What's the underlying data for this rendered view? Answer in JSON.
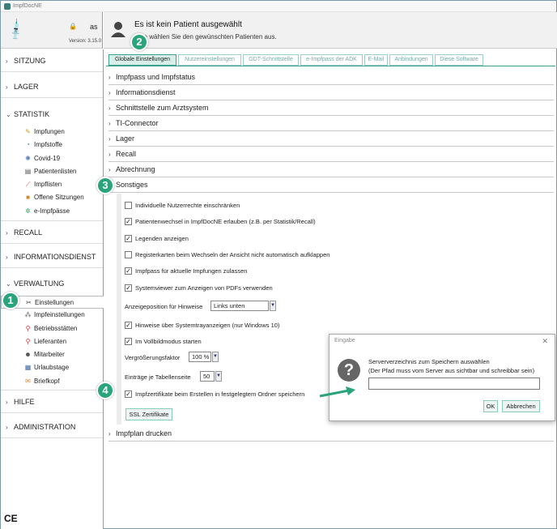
{
  "app": {
    "title": "ImpfDocNE",
    "user": "as",
    "version": "Version: 3.15.0"
  },
  "patient": {
    "title": "Es ist kein Patient ausgewählt",
    "subtitle": "Bitte wählen Sie den gewünschten Patienten aus."
  },
  "callouts": [
    "1",
    "2",
    "3",
    "4"
  ],
  "sidebar": {
    "sections": [
      {
        "label": "SITZUNG",
        "expanded": false
      },
      {
        "label": "LAGER",
        "expanded": false
      },
      {
        "label": "STATISTIK",
        "expanded": true,
        "items": [
          {
            "label": "Impfungen",
            "icon": "syringe-icon"
          },
          {
            "label": "Impfstoffe",
            "icon": "vial-icon"
          },
          {
            "label": "Covid-19",
            "icon": "virus-icon"
          },
          {
            "label": "Patientenlisten",
            "icon": "list-icon"
          },
          {
            "label": "Impflisten",
            "icon": "needle-icon"
          },
          {
            "label": "Offene Sitzungen",
            "icon": "box-icon"
          },
          {
            "label": "e-Impfpässe",
            "icon": "gear-icon"
          }
        ]
      },
      {
        "label": "RECALL",
        "expanded": false
      },
      {
        "label": "INFORMATIONSDIENST",
        "expanded": false
      },
      {
        "label": "VERWALTUNG",
        "expanded": true,
        "items": [
          {
            "label": "Einstellungen",
            "icon": "tools-icon",
            "active": true
          },
          {
            "label": "Impfeinstellungen",
            "icon": "dots-icon"
          },
          {
            "label": "Betriebsstätten",
            "icon": "pin-icon"
          },
          {
            "label": "Lieferanten",
            "icon": "pin-icon"
          },
          {
            "label": "Mitarbeiter",
            "icon": "people-icon"
          },
          {
            "label": "Urlaubstage",
            "icon": "calendar-icon"
          },
          {
            "label": "Briefkopf",
            "icon": "letter-icon"
          }
        ]
      },
      {
        "label": "HILFE",
        "expanded": false
      },
      {
        "label": "ADMINISTRATION",
        "expanded": false
      }
    ],
    "ce_mark": "CE"
  },
  "tabs": [
    {
      "label": "Globale Einstellungen",
      "active": true
    },
    {
      "label": "Nutzereinstellungen"
    },
    {
      "label": "GDT-Schnittstelle"
    },
    {
      "label": "e-Impfpass der ADK"
    },
    {
      "label": "E-Mail"
    },
    {
      "label": "Anbindungen"
    },
    {
      "label": "Diese Software"
    }
  ],
  "sections": [
    "Impfpass und Impfstatus",
    "Informationsdienst",
    "Schnittstelle zum Arztsystem",
    "TI-Connector",
    "Lager",
    "Recall",
    "Abrechnung",
    "Sonstiges",
    "Impfplan drucken"
  ],
  "sonstiges": {
    "options": [
      {
        "label": "Individuelle Nutzerrechte einschränken",
        "checked": false
      },
      {
        "label": "Patientenwechsel in ImpfDocNE erlauben (z.B. per Statistik/Recall)",
        "checked": true
      },
      {
        "label": "Legenden anzeigen",
        "checked": true
      },
      {
        "label": "Registerkarten beim Wechseln der Ansicht nicht automatisch aufklappen",
        "checked": false
      },
      {
        "label": "Impfpass für aktuelle Impfungen zulassen",
        "checked": true
      },
      {
        "label": "Systemviewer zum Anzeigen von PDFs verwenden",
        "checked": true
      },
      {
        "label": "Hinweise über Systemtrayanzeigen (nur Windows 10)",
        "checked": true
      },
      {
        "label": "Im Vollbildmodus starten",
        "checked": true
      },
      {
        "label": "Impfzertifikate beim Erstellen in festgelegtem Ordner speichern",
        "checked": true
      }
    ],
    "hint_position": {
      "label": "Anzeigeposition für Hinweise",
      "value": "Links unten"
    },
    "zoom": {
      "label": "Vergrößerungsfaktor",
      "value": "100 %"
    },
    "rows": {
      "label": "Einträge je Tabellenseite",
      "value": "50"
    },
    "ssl_button": "SSL Zertifikate"
  },
  "dialog": {
    "title": "Eingabe",
    "line1": "Serververzeichnis zum Speichern auswählen",
    "line2": "(Der Pfad muss vom Server aus sichtbar und schreibbar sein)",
    "input_value": "",
    "ok": "OK",
    "cancel": "Abbrechen",
    "close": "✕"
  },
  "colors": {
    "accent": "#3aa08c",
    "callout": "#2aa47a",
    "tab_active_bg": "#d8efe9"
  }
}
